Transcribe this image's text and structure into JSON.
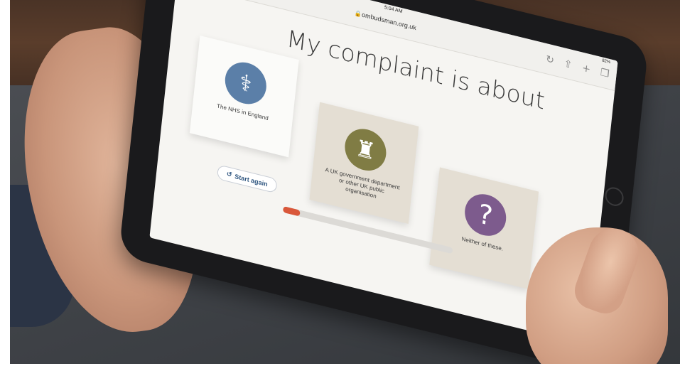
{
  "browser": {
    "time": "5:04 AM",
    "domain": "ombudsman.org.uk",
    "battery": "82%"
  },
  "page": {
    "heading": "My complaint is about"
  },
  "options": [
    {
      "label": "The NHS in England",
      "icon": "stethoscope-icon",
      "color": "#5b7fa8"
    },
    {
      "label": "A UK government department or other UK public organisation",
      "icon": "big-ben-icon",
      "color": "#807c44"
    },
    {
      "label": "Neither of these.",
      "icon": "question-mark-icon",
      "color": "#7d5b8d"
    }
  ],
  "controls": {
    "start_again": "Start again"
  },
  "progress": {
    "fraction": 0.1
  },
  "colors": {
    "accent": "#d9573a",
    "button_text": "#2f5680"
  }
}
